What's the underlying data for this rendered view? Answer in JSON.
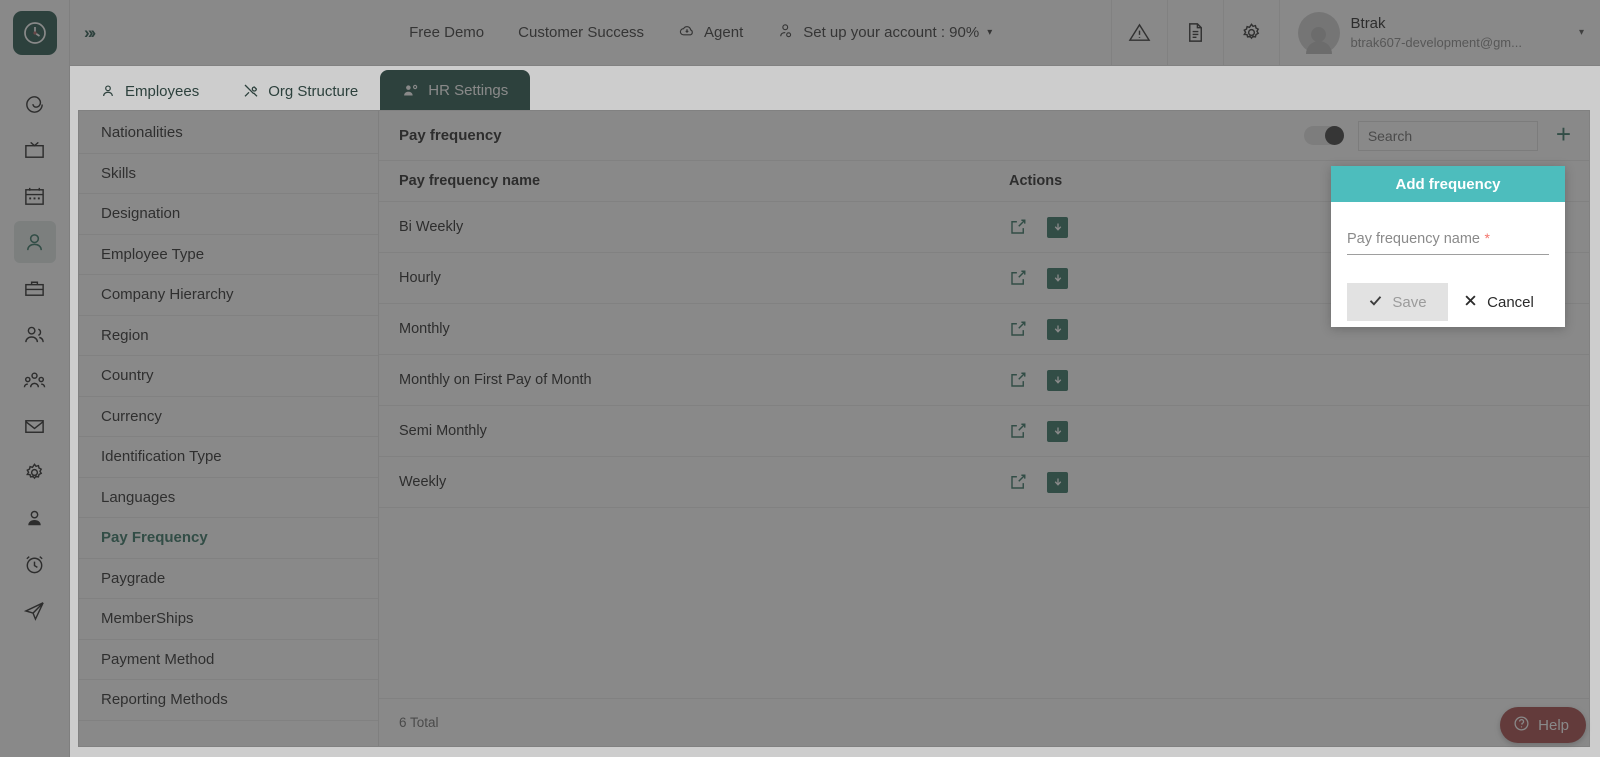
{
  "brand": {
    "logo_icon": "clock-logo-icon",
    "primary_green": "#0d6251",
    "accent_green": "#0d8064",
    "dialog_teal": "#4dbdbd",
    "help_red": "#e03b3b",
    "expand_chevrons": "»›"
  },
  "rail": {
    "items": [
      {
        "icon": "target-spiral-icon",
        "active": false
      },
      {
        "icon": "tv-monitor-icon",
        "active": false
      },
      {
        "icon": "calendar-icon",
        "active": false
      },
      {
        "icon": "user-icon",
        "active": true
      },
      {
        "icon": "briefcase-icon",
        "active": false
      },
      {
        "icon": "two-users-icon",
        "active": false
      },
      {
        "icon": "user-group-icon",
        "active": false
      },
      {
        "icon": "envelope-icon",
        "active": false
      },
      {
        "icon": "gear-icon",
        "active": false
      },
      {
        "icon": "user-badge-icon",
        "active": false
      },
      {
        "icon": "alarm-clock-icon",
        "active": false
      },
      {
        "icon": "paper-plane-icon",
        "active": false
      }
    ]
  },
  "topbar": {
    "links": [
      {
        "label": "Free Demo",
        "icon": null
      },
      {
        "label": "Customer Success",
        "icon": null
      },
      {
        "label": "Agent",
        "icon": "cloud-agent-icon"
      },
      {
        "label": "Set up your account : 90%",
        "icon": "account-setup-icon",
        "caret": "▾"
      }
    ],
    "icons": [
      {
        "name": "warning-triangle-icon"
      },
      {
        "name": "document-icon"
      },
      {
        "name": "gear-icon"
      }
    ],
    "profile": {
      "name": "Btrak",
      "email": "btrak607-development@gm...",
      "caret": "▾",
      "avatar_icon": "avatar-placeholder-icon"
    }
  },
  "tabs": [
    {
      "label": "Employees",
      "icon": "person-icon",
      "active": false
    },
    {
      "label": "Org Structure",
      "icon": "tools-icon",
      "active": false
    },
    {
      "label": "HR Settings",
      "icon": "people-gear-icon",
      "active": true
    }
  ],
  "sidelist": {
    "items": [
      {
        "label": "Nationalities",
        "active": false
      },
      {
        "label": "Skills",
        "active": false
      },
      {
        "label": "Designation",
        "active": false
      },
      {
        "label": "Employee Type",
        "active": false
      },
      {
        "label": "Company Hierarchy",
        "active": false
      },
      {
        "label": "Region",
        "active": false
      },
      {
        "label": "Country",
        "active": false
      },
      {
        "label": "Currency",
        "active": false
      },
      {
        "label": "Identification Type",
        "active": false
      },
      {
        "label": "Languages",
        "active": false
      },
      {
        "label": "Pay Frequency",
        "active": true
      },
      {
        "label": "Paygrade",
        "active": false
      },
      {
        "label": "MemberShips",
        "active": false
      },
      {
        "label": "Payment Method",
        "active": false
      },
      {
        "label": "Reporting Methods",
        "active": false
      }
    ]
  },
  "panel": {
    "title": "Pay frequency",
    "toggle_on": false,
    "search_placeholder": "Search",
    "search_value": "",
    "add_label": "+",
    "columns": {
      "name": "Pay frequency name",
      "actions": "Actions"
    },
    "rows": [
      {
        "name": "Bi Weekly"
      },
      {
        "name": "Hourly"
      },
      {
        "name": "Monthly"
      },
      {
        "name": "Monthly on First Pay of Month"
      },
      {
        "name": "Semi Monthly"
      },
      {
        "name": "Weekly"
      }
    ],
    "total_label": "6 Total"
  },
  "dialog": {
    "title": "Add frequency",
    "field_label": "Pay frequency name",
    "field_required_mark": "*",
    "field_value": "",
    "save_label": "Save",
    "cancel_label": "Cancel"
  },
  "help": {
    "label": "Help",
    "icon": "question-circle-icon"
  }
}
